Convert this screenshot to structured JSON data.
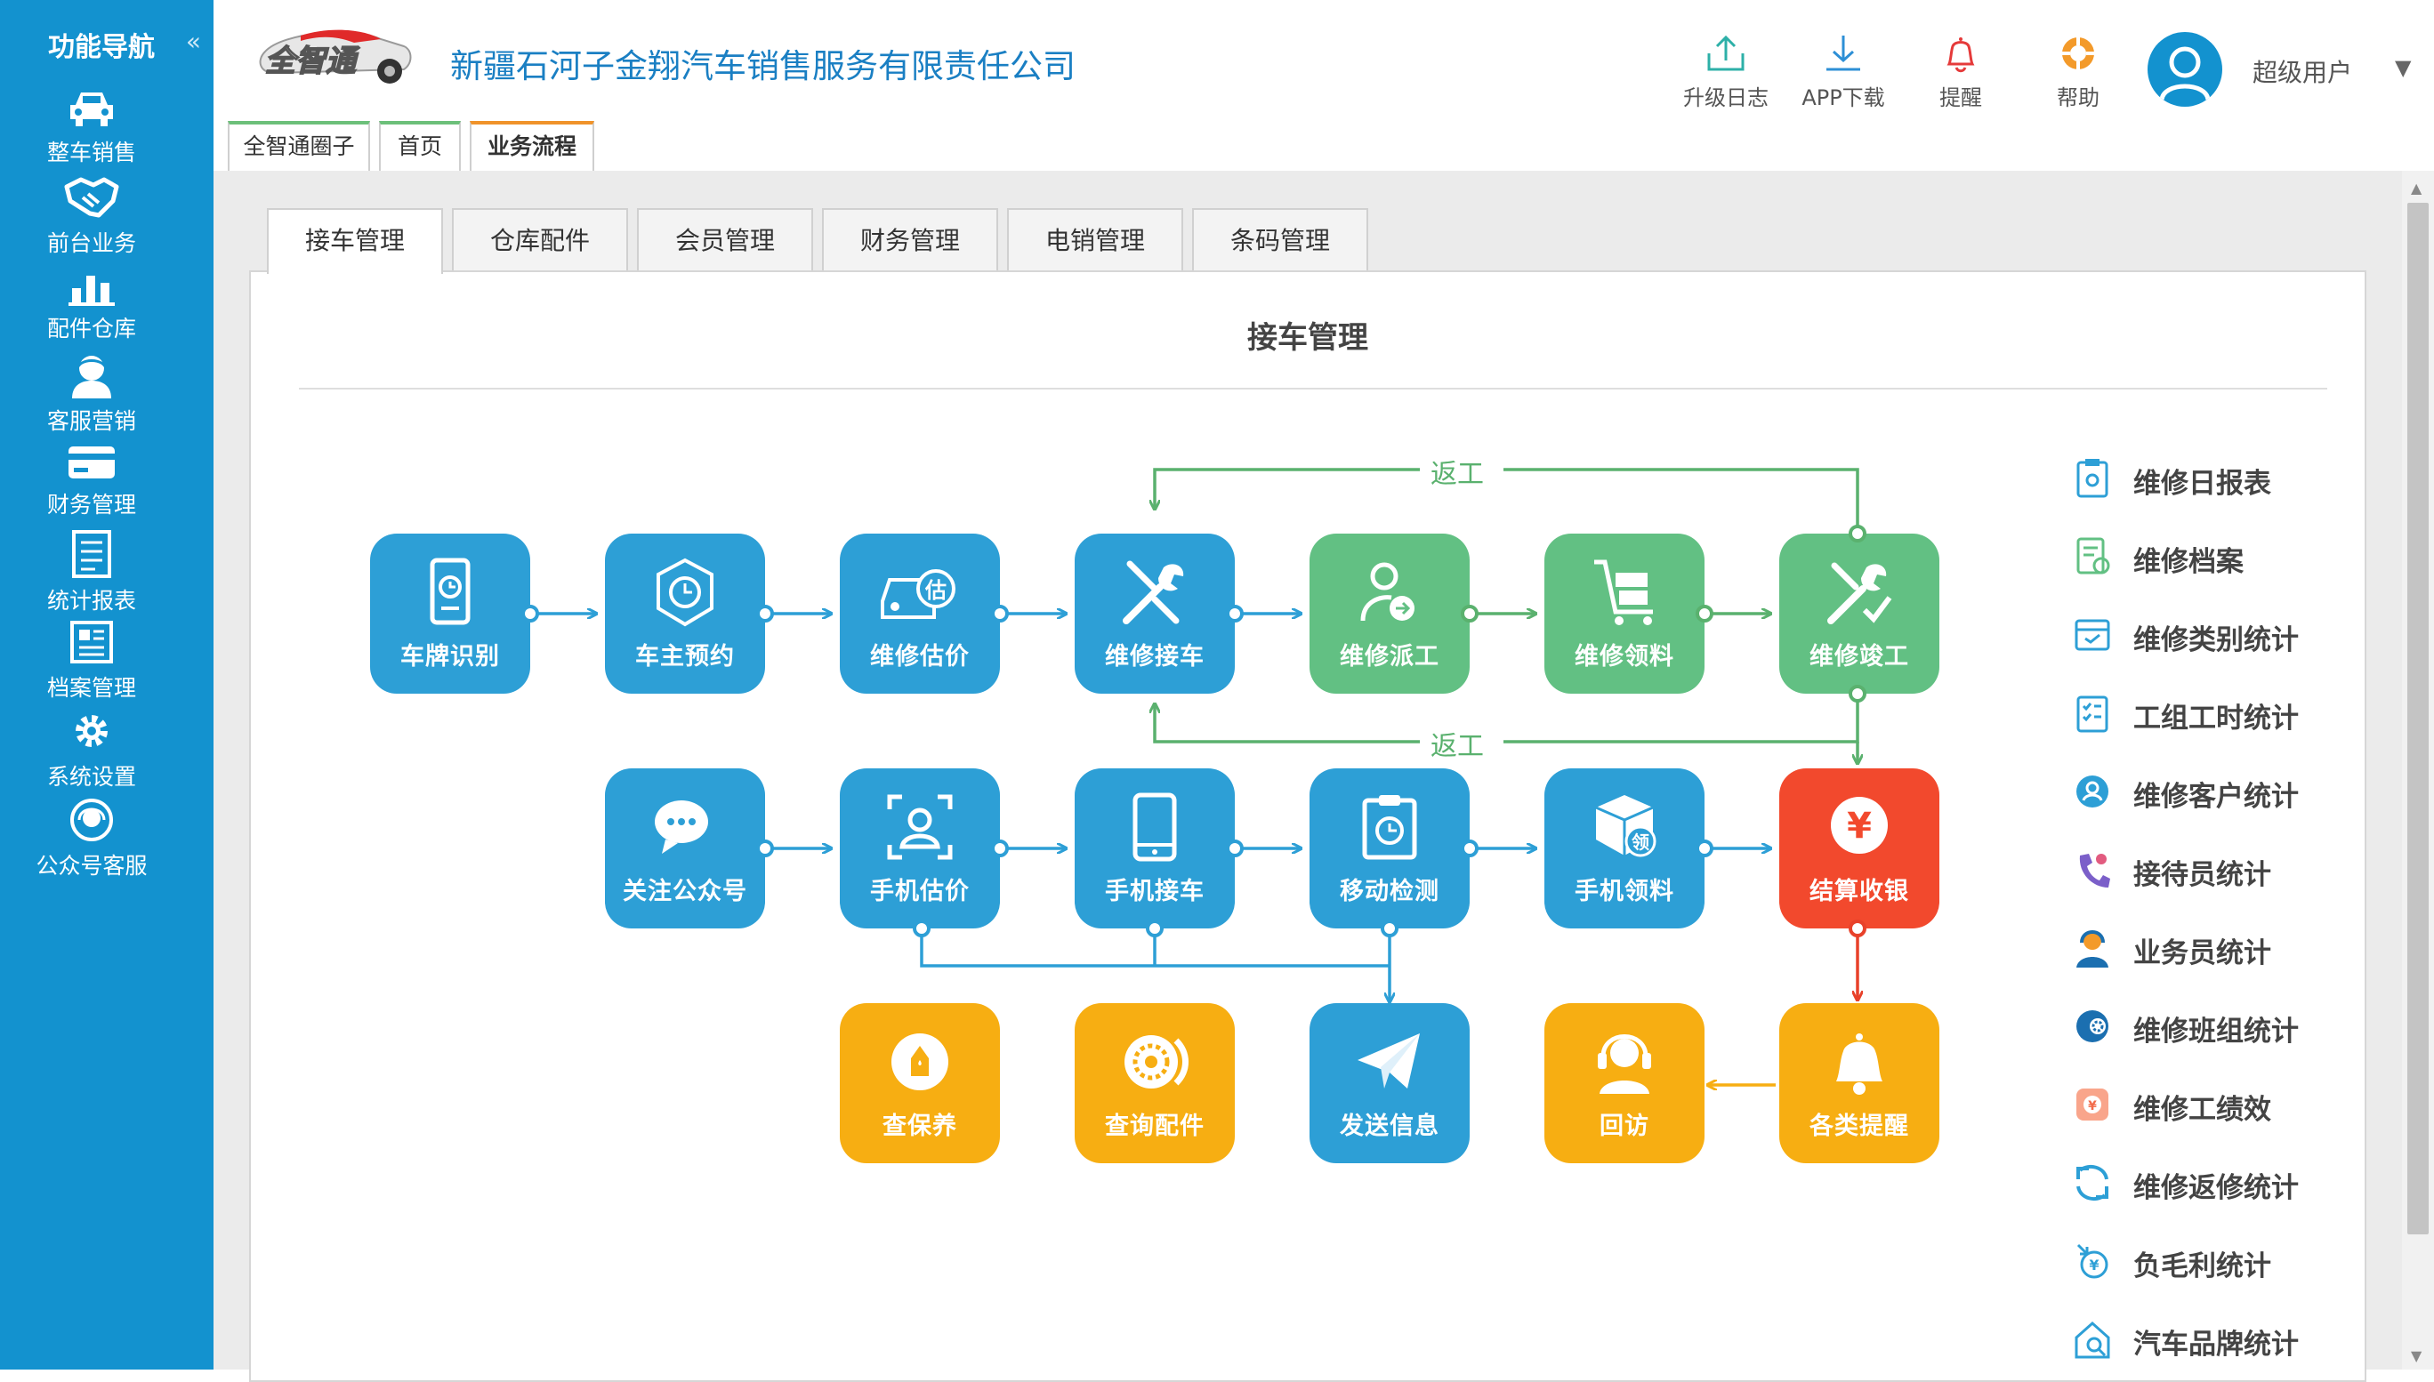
{
  "sidebar": {
    "title": "功能导航",
    "collapse": "«",
    "items": [
      {
        "label": "整车销售",
        "icon": "car-icon"
      },
      {
        "label": "前台业务",
        "icon": "handshake-icon"
      },
      {
        "label": "配件仓库",
        "icon": "warehouse-icon"
      },
      {
        "label": "客服营销",
        "icon": "customer-service-icon"
      },
      {
        "label": "财务管理",
        "icon": "card-icon"
      },
      {
        "label": "统计报表",
        "icon": "report-icon"
      },
      {
        "label": "档案管理",
        "icon": "archive-icon"
      },
      {
        "label": "系统设置",
        "icon": "gear-icon"
      },
      {
        "label": "公众号客服",
        "icon": "wechat-service-icon"
      }
    ]
  },
  "header": {
    "logo_text": "全智通",
    "company": "新疆石河子金翔汽车销售服务有限责任公司",
    "tools": [
      {
        "label": "升级日志",
        "icon": "upload-icon"
      },
      {
        "label": "APP下载",
        "icon": "download-icon"
      },
      {
        "label": "提醒",
        "icon": "bell-icon"
      },
      {
        "label": "帮助",
        "icon": "help-icon"
      }
    ],
    "username": "超级用户",
    "user_caret": "▼",
    "tabs": [
      {
        "label": "全智通圈子"
      },
      {
        "label": "首页"
      },
      {
        "label": "业务流程"
      }
    ]
  },
  "sub_tabs": [
    {
      "label": "接车管理"
    },
    {
      "label": "仓库配件"
    },
    {
      "label": "会员管理"
    },
    {
      "label": "财务管理"
    },
    {
      "label": "电销管理"
    },
    {
      "label": "条码管理"
    }
  ],
  "panel": {
    "title": "接车管理",
    "rework_label": "返工",
    "flow_row1": [
      {
        "label": "车牌识别",
        "icon": "plate-scan-icon"
      },
      {
        "label": "车主预约",
        "icon": "clock-icon"
      },
      {
        "label": "维修估价",
        "icon": "estimate-icon"
      },
      {
        "label": "维修接车",
        "icon": "tools-icon"
      },
      {
        "label": "维修派工",
        "icon": "dispatch-icon"
      },
      {
        "label": "维修领料",
        "icon": "cart-icon"
      },
      {
        "label": "维修竣工",
        "icon": "complete-icon"
      }
    ],
    "flow_row2": [
      {
        "label": "关注公众号",
        "icon": "wechat-icon"
      },
      {
        "label": "手机估价",
        "icon": "face-scan-icon"
      },
      {
        "label": "手机接车",
        "icon": "phone-icon"
      },
      {
        "label": "移动检测",
        "icon": "inspection-icon"
      },
      {
        "label": "手机领料",
        "icon": "box-icon"
      },
      {
        "label": "结算收银",
        "icon": "yen-icon"
      }
    ],
    "flow_row3": [
      {
        "label": "查保养",
        "icon": "oil-icon"
      },
      {
        "label": "查询配件",
        "icon": "brake-icon"
      },
      {
        "label": "发送信息",
        "icon": "send-icon"
      },
      {
        "label": "回访",
        "icon": "headset-icon"
      },
      {
        "label": "各类提醒",
        "icon": "bell-icon"
      }
    ],
    "estimate_badge": "估",
    "parts_badge": "领",
    "yen_symbol": "¥"
  },
  "stats": [
    {
      "label": "维修日报表",
      "icon": "daily-report-icon",
      "color": "#2d9fd6"
    },
    {
      "label": "维修档案",
      "icon": "archive-file-icon",
      "color": "#62c083"
    },
    {
      "label": "维修类别统计",
      "icon": "category-icon",
      "color": "#2d9fd6"
    },
    {
      "label": "工组工时统计",
      "icon": "checklist-icon",
      "color": "#2d9fd6"
    },
    {
      "label": "维修客户统计",
      "icon": "customer-icon",
      "color": "#2d9fd6"
    },
    {
      "label": "接待员统计",
      "icon": "phone-call-icon",
      "color": "#7b5fc9"
    },
    {
      "label": "业务员统计",
      "icon": "salesman-icon",
      "color": "#1b6fb0"
    },
    {
      "label": "维修班组统计",
      "icon": "team-icon",
      "color": "#1b6fb0"
    },
    {
      "label": "维修工绩效",
      "icon": "performance-icon",
      "color": "#f26b4b"
    },
    {
      "label": "维修返修统计",
      "icon": "rework-icon",
      "color": "#2d9fd6"
    },
    {
      "label": "负毛利统计",
      "icon": "loss-icon",
      "color": "#2d9fd6"
    },
    {
      "label": "汽车品牌统计",
      "icon": "brand-icon",
      "color": "#2d9fd6"
    }
  ],
  "colors": {
    "sidebar": "#1392cf",
    "node_blue": "#2d9fd6",
    "node_green": "#62c083",
    "node_red": "#f2492d",
    "node_orange": "#f7ae12",
    "arrow_blue": "#2d9fd6",
    "arrow_green": "#5ab16e",
    "arrow_red": "#e8412a"
  }
}
